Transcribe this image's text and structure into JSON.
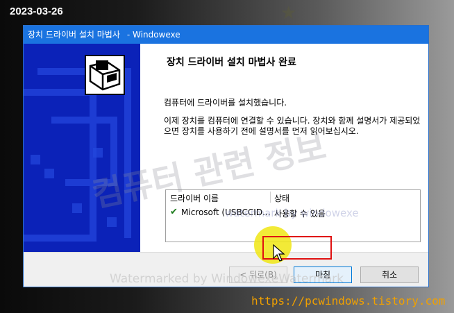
{
  "screenshot": {
    "date": "2023-03-26",
    "site_url": "https://pcwindows.tistory.com"
  },
  "watermarks": {
    "korean": "컴퓨터 관련 정보",
    "english_center": "watermark by windowexe",
    "english_bottom": "Watermarked by WindowexeWatermark"
  },
  "dialog": {
    "title": "장치 드라이버 설치 마법사",
    "title_suffix": "- Windowexe",
    "heading": "장치 드라이버 설치 마법사 완료",
    "paragraph1": "컴퓨터에 드라이버를 설치했습니다.",
    "paragraph2": "이제 장치를 컴퓨터에 연결할 수 있습니다. 장치와 함께 설명서가 제공되었으면 장치를 사용하기 전에 설명서를 먼저 읽어보십시오.",
    "list": {
      "columns": [
        "드라이버 이름",
        "상태"
      ],
      "rows": [
        {
          "name": "Microsoft (USBCCID...",
          "status": "사용할 수 있음",
          "icon": "checkmark-icon"
        }
      ]
    },
    "buttons": {
      "back": "< 뒤로(B)",
      "finish": "마침",
      "cancel": "취소"
    }
  },
  "colors": {
    "titlebar": "#1a73e0",
    "panel": "#0b22b8",
    "highlight": "#e01010",
    "url": "#f0a000"
  }
}
